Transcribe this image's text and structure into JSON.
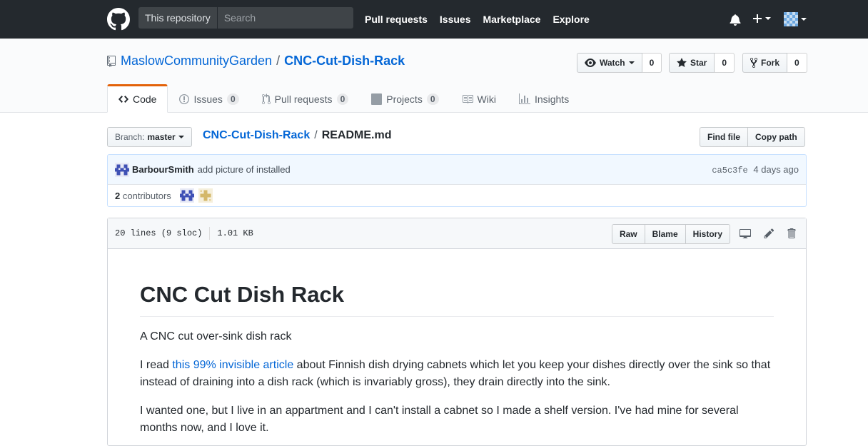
{
  "header": {
    "search_scope": "This repository",
    "search_placeholder": "Search",
    "nav": [
      "Pull requests",
      "Issues",
      "Marketplace",
      "Explore"
    ]
  },
  "repo": {
    "owner": "MaslowCommunityGarden",
    "separator": "/",
    "name": "CNC-Cut-Dish-Rack",
    "watch_label": "Watch",
    "watch_count": "0",
    "star_label": "Star",
    "star_count": "0",
    "fork_label": "Fork",
    "fork_count": "0"
  },
  "tabs": [
    {
      "label": "Code",
      "icon": "code-icon"
    },
    {
      "label": "Issues",
      "counter": "0",
      "icon": "issue-icon"
    },
    {
      "label": "Pull requests",
      "counter": "0",
      "icon": "pull-request-icon"
    },
    {
      "label": "Projects",
      "counter": "0",
      "icon": "project-icon"
    },
    {
      "label": "Wiki",
      "icon": "book-icon"
    },
    {
      "label": "Insights",
      "icon": "graph-icon"
    }
  ],
  "file_nav": {
    "branch_prefix": "Branch:",
    "branch": "master",
    "repo_link": "CNC-Cut-Dish-Rack",
    "separator": "/",
    "file": "README.md",
    "find_file": "Find file",
    "copy_path": "Copy path"
  },
  "commit": {
    "author": "BarbourSmith",
    "message": "add picture of installed",
    "sha": "ca5c3fe",
    "time": "4 days ago"
  },
  "contributors": {
    "count": "2",
    "label": "contributors"
  },
  "file": {
    "lines": "20 lines (9 sloc)",
    "size": "1.01 KB",
    "raw": "Raw",
    "blame": "Blame",
    "history": "History"
  },
  "readme": {
    "title": "CNC Cut Dish Rack",
    "p1": "A CNC cut over-sink dish rack",
    "p2_pre": "I read ",
    "p2_link": "this 99% invisible article",
    "p2_post": " about Finnish dish drying cabnets which let you keep your dishes directly over the sink so that instead of draining into a dish rack (which is invariably gross), they drain directly into the sink.",
    "p3": "I wanted one, but I live in an appartment and I can't install a cabnet so I made a shelf version. I've had mine for several months now, and I love it."
  },
  "colors": {
    "header_bg": "#24292e",
    "link": "#0366d6",
    "selected_tab_accent": "#e36209",
    "commit_bg": "#f1f8ff"
  }
}
